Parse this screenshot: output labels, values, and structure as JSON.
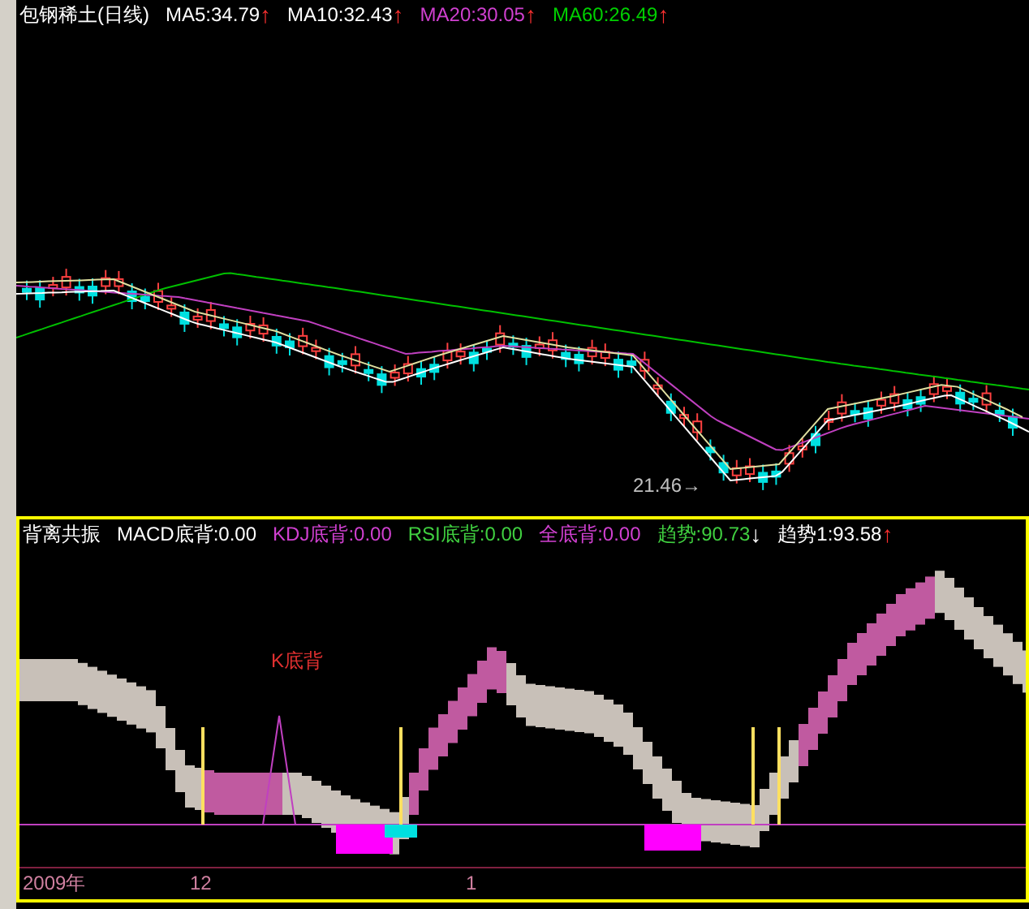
{
  "price_panel": {
    "title": "包钢稀土(日线)",
    "indicators": [
      {
        "label": "MA5:34.79",
        "color": "#ffffff",
        "arrow": {
          "symbol": "↑",
          "color": "#ff3030"
        }
      },
      {
        "label": "MA10:32.43",
        "color": "#ffffff",
        "arrow": {
          "symbol": "↑",
          "color": "#ff3030"
        }
      },
      {
        "label": "MA20:30.05",
        "color": "#d040d0",
        "arrow": {
          "symbol": "↑",
          "color": "#ff3030"
        }
      },
      {
        "label": "MA60:26.49",
        "color": "#00d000",
        "arrow": {
          "symbol": "↑",
          "color": "#ff3030"
        }
      }
    ],
    "low_marker": "21.46→"
  },
  "signal_panel": {
    "title": "背离共振",
    "indicators": [
      {
        "label": "MACD底背:0.00",
        "color": "#ffffff"
      },
      {
        "label": "KDJ底背:0.00",
        "color": "#d040d0"
      },
      {
        "label": "RSI底背:0.00",
        "color": "#40d040"
      },
      {
        "label": "全底背:0.00",
        "color": "#d040d0"
      },
      {
        "label": "趋势:90.73",
        "color": "#40d040",
        "arrow": {
          "symbol": "↓",
          "color": "#ffffff"
        }
      },
      {
        "label": "趋势1:93.58",
        "color": "#ffffff",
        "arrow": {
          "symbol": "↑",
          "color": "#ff3030"
        }
      }
    ],
    "annotation": "K底背"
  },
  "time_axis": [
    "2009年",
    "12",
    "1"
  ]
}
